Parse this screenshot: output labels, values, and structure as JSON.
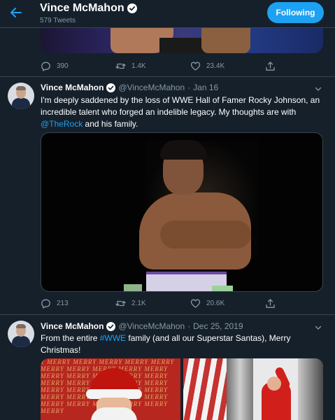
{
  "header": {
    "name": "Vince McMahon",
    "tweet_count": "579 Tweets",
    "follow_label": "Following"
  },
  "colors": {
    "accent": "#1da1f2",
    "background": "#15202b",
    "muted": "#8899a6"
  },
  "top_actions": {
    "replies": "390",
    "retweets": "1.4K",
    "likes": "23.4K"
  },
  "tweets": [
    {
      "name": "Vince McMahon",
      "handle": "@VinceMcMahon",
      "sep": "·",
      "date": "Jan 16",
      "text_1": "I'm deeply saddened by the loss of WWE Hall of Famer Rocky Johnson, an incredible talent who forged an indelible legacy. My thoughts are with ",
      "link_1": "@TheRock",
      "text_2": " and his family.",
      "replies": "213",
      "retweets": "2.1K",
      "likes": "20.6K"
    },
    {
      "name": "Vince McMahon",
      "handle": "@VinceMcMahon",
      "sep": "·",
      "date": "Dec 25, 2019",
      "text_1": "From the entire ",
      "link_1": "#WWE",
      "text_2": " family (and all our Superstar Santas), Merry Christmas!"
    }
  ],
  "media2_bgtext": "Y MERRY MERRY MERRY MERRY MERRY MERRY MERRY MERRY MERRY MERRY MERRY MERRY MERRY MERRY MERRY MERRY MERRY MERRY MERRY MERRY MERRY MERRY MERRY MERRY MERRY MERRY MERRY MERRY MERRY MERRY MERRY MERRY MERRY MERRY MERRY MERRY",
  "icons": [
    "back-arrow-icon",
    "verified-badge-icon",
    "reply-icon",
    "retweet-icon",
    "like-icon",
    "share-icon",
    "chevron-down-icon"
  ]
}
